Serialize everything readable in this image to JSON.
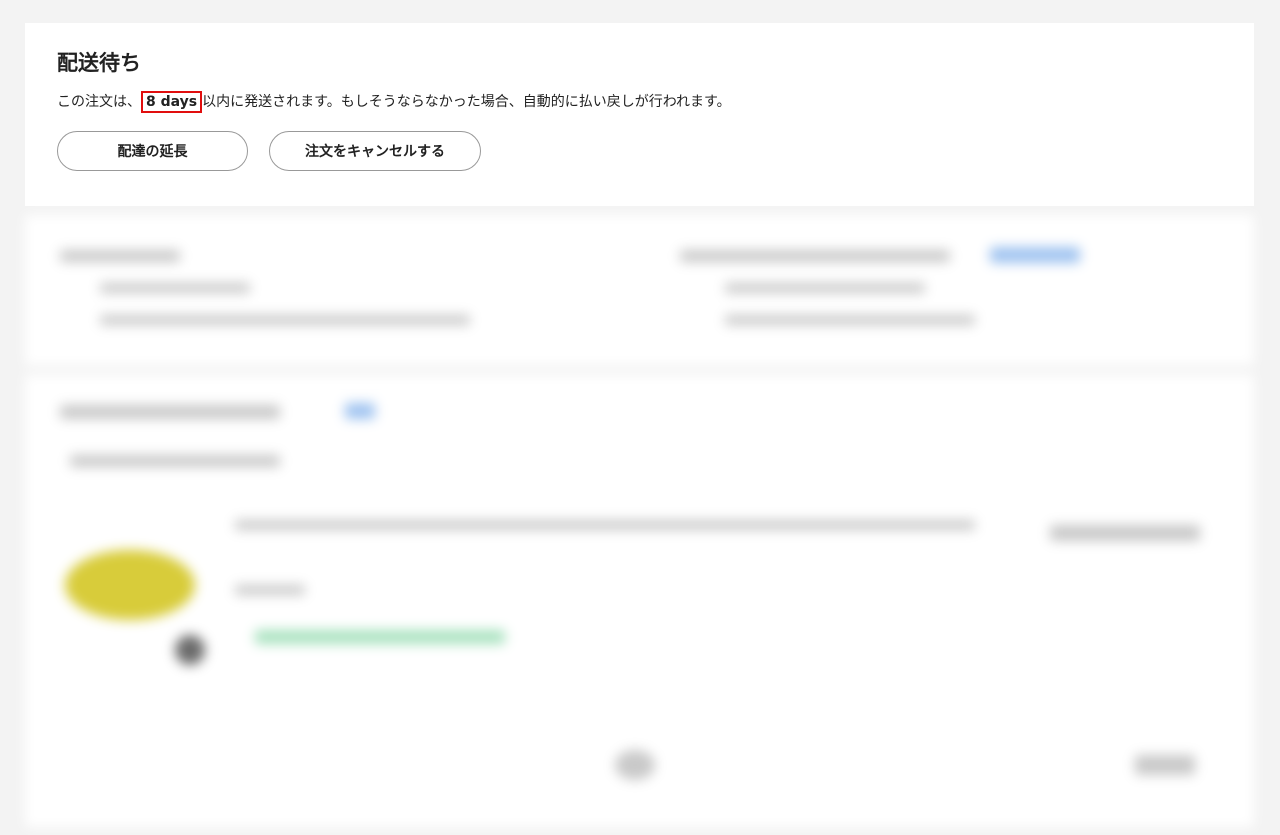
{
  "status": {
    "title": "配送待ち",
    "message_prefix": "この注文は、",
    "days": "8 days",
    "message_suffix": "以内に発送されます。もしそうならなかった場合、自動的に払い戻しが行われます。"
  },
  "actions": {
    "extend_label": "配達の延長",
    "cancel_label": "注文をキャンセルする"
  },
  "colors": {
    "highlight_border": "#e10e0e",
    "page_background": "#f3f3f3"
  }
}
